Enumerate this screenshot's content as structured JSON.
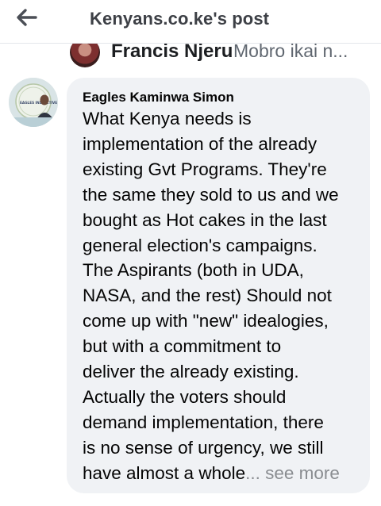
{
  "header": {
    "title": "Kenyans.co.ke's post"
  },
  "previous_comment": {
    "author": "Francis Njeru",
    "preview": "Mobro ikai n..."
  },
  "comment": {
    "author": "Eagles Kaminwa Simon",
    "lines": [
      "What Kenya needs is",
      "implementation of the already",
      "existing Gvt Programs. They're",
      "the same they sold to us and we",
      "bought as Hot cakes in the last",
      "general election's campaigns.",
      "The Aspirants (both in UDA,",
      "NASA, and the rest) Should not",
      "come up with \"new\" idealogies,",
      "but with a commitment to",
      "deliver the already existing.",
      "Actually the voters should",
      "demand implementation, there",
      "is no sense of urgency, we still"
    ],
    "last_line": "have almost a whole",
    "see_more": "... see more",
    "avatar_logo_text": "EAGLES INSPECTIVE"
  },
  "icons": {
    "back": "arrow-left-icon"
  },
  "colors": {
    "header_title": "#3d4046",
    "bubble_bg": "#f0f2f5",
    "see_more": "#8a8d91"
  }
}
